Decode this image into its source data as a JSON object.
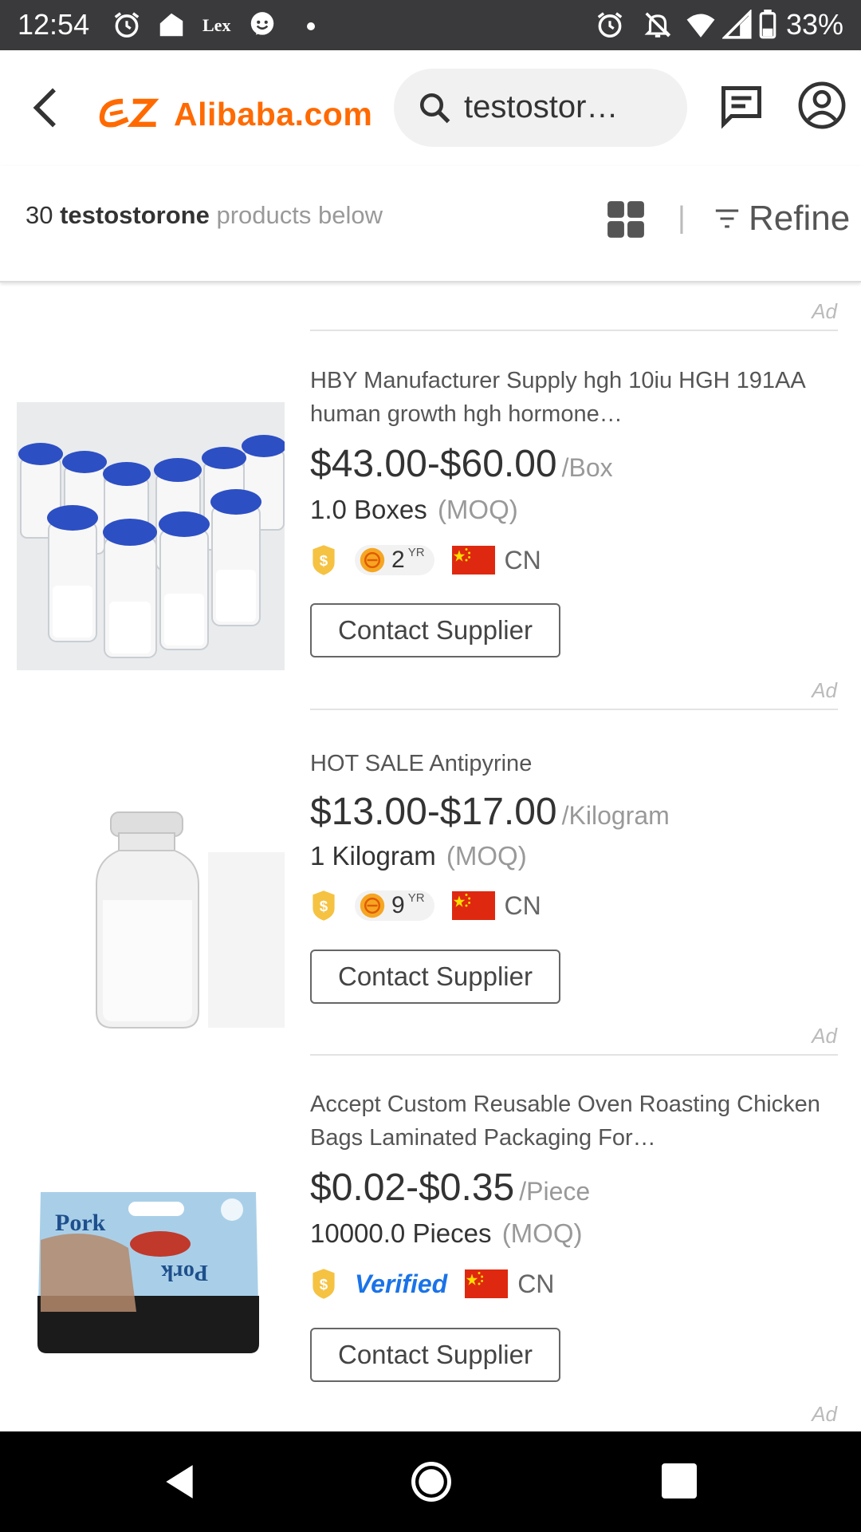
{
  "status_bar": {
    "time": "12:54",
    "lex_label": "Lex",
    "battery_pct": "33%",
    "icons": [
      "alarm-icon",
      "home-icon",
      "lex-app-icon",
      "messenger-icon",
      "dot-icon",
      "alarm-icon",
      "notifications-off-icon",
      "wifi-icon",
      "signal-icon",
      "battery-icon"
    ]
  },
  "header": {
    "logo": "Alibaba.com",
    "search_value": "testostor…",
    "icons": [
      "back-arrow-icon",
      "search-icon",
      "message-icon",
      "account-icon"
    ]
  },
  "results": {
    "count": "30",
    "keyword": "testostorone",
    "suffix": "products below",
    "refine_label": "Refine"
  },
  "ad_label": "Ad",
  "products": [
    {
      "title": "HBY Manufacturer Supply hgh 10iu HGH 191AA human growth hgh hormone…",
      "price": "$43.00-$60.00",
      "unit": "/Box",
      "moq_qty": "1.0 Boxes",
      "moq_tag": "(MOQ)",
      "years": "2",
      "yr_label": "YR",
      "country": "CN",
      "contact_label": "Contact Supplier"
    },
    {
      "title": "HOT SALE Antipyrine",
      "price": "$13.00-$17.00",
      "unit": "/Kilogram",
      "moq_qty": "1 Kilogram",
      "moq_tag": "(MOQ)",
      "years": "9",
      "yr_label": "YR",
      "country": "CN",
      "contact_label": "Contact Supplier"
    },
    {
      "title": "Accept Custom Reusable Oven Roasting Chicken Bags Laminated Packaging For…",
      "price": "$0.02-$0.35",
      "unit": "/Piece",
      "moq_qty": "10000.0 Pieces",
      "moq_tag": "(MOQ)",
      "verified_label": "Verified",
      "country": "CN",
      "contact_label": "Contact Supplier"
    }
  ],
  "colors": {
    "brand": "#ff6a00",
    "status_bar": "#3a3a3c",
    "verified": "#1a73e8",
    "flag_red": "#de2910",
    "flag_star": "#ffde00"
  }
}
